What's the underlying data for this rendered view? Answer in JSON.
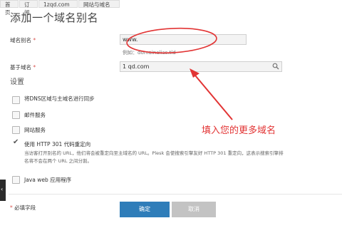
{
  "breadcrumb": {
    "items": [
      {
        "label": "首页"
      },
      {
        "label": "订阅"
      },
      {
        "label": "1zqd.com"
      },
      {
        "label": "网站与域名"
      }
    ]
  },
  "page_title": "添加一个域名别名",
  "form": {
    "alias_label": "域名别名",
    "alias_prefix": "www.",
    "alias_value": "",
    "alias_example": "例如：domainalias.tld",
    "base_label": "基于域名",
    "base_value": "1  qd.com",
    "required_mark": "*"
  },
  "settings": {
    "title": "设置",
    "options": [
      {
        "label": "将DNS区域与主域名进行同步",
        "checked": false
      },
      {
        "label": "邮件服务",
        "checked": false
      },
      {
        "label": "网站服务",
        "checked": false
      },
      {
        "label": "使用 HTTP 301 代码重定向",
        "checked": true
      },
      {
        "label": "Java web 应用程序",
        "checked": false
      }
    ],
    "redirect_description": "当访客打开别名的 URL，他们将会被重定向至主域名的 URL。Plesk 会使搜索引擎友好 HTTP 301 重定向，这表示搜索引擎排名将不会在两个 URL 之间分割。"
  },
  "footer": {
    "required_note": "必填字段",
    "ok_label": "确定",
    "cancel_label": "取消"
  },
  "annotation": {
    "text": "填入您的更多域名",
    "color": "#e23434"
  },
  "colors": {
    "primary_button": "#2f7db9",
    "cancel_button": "#c3c3c3"
  }
}
